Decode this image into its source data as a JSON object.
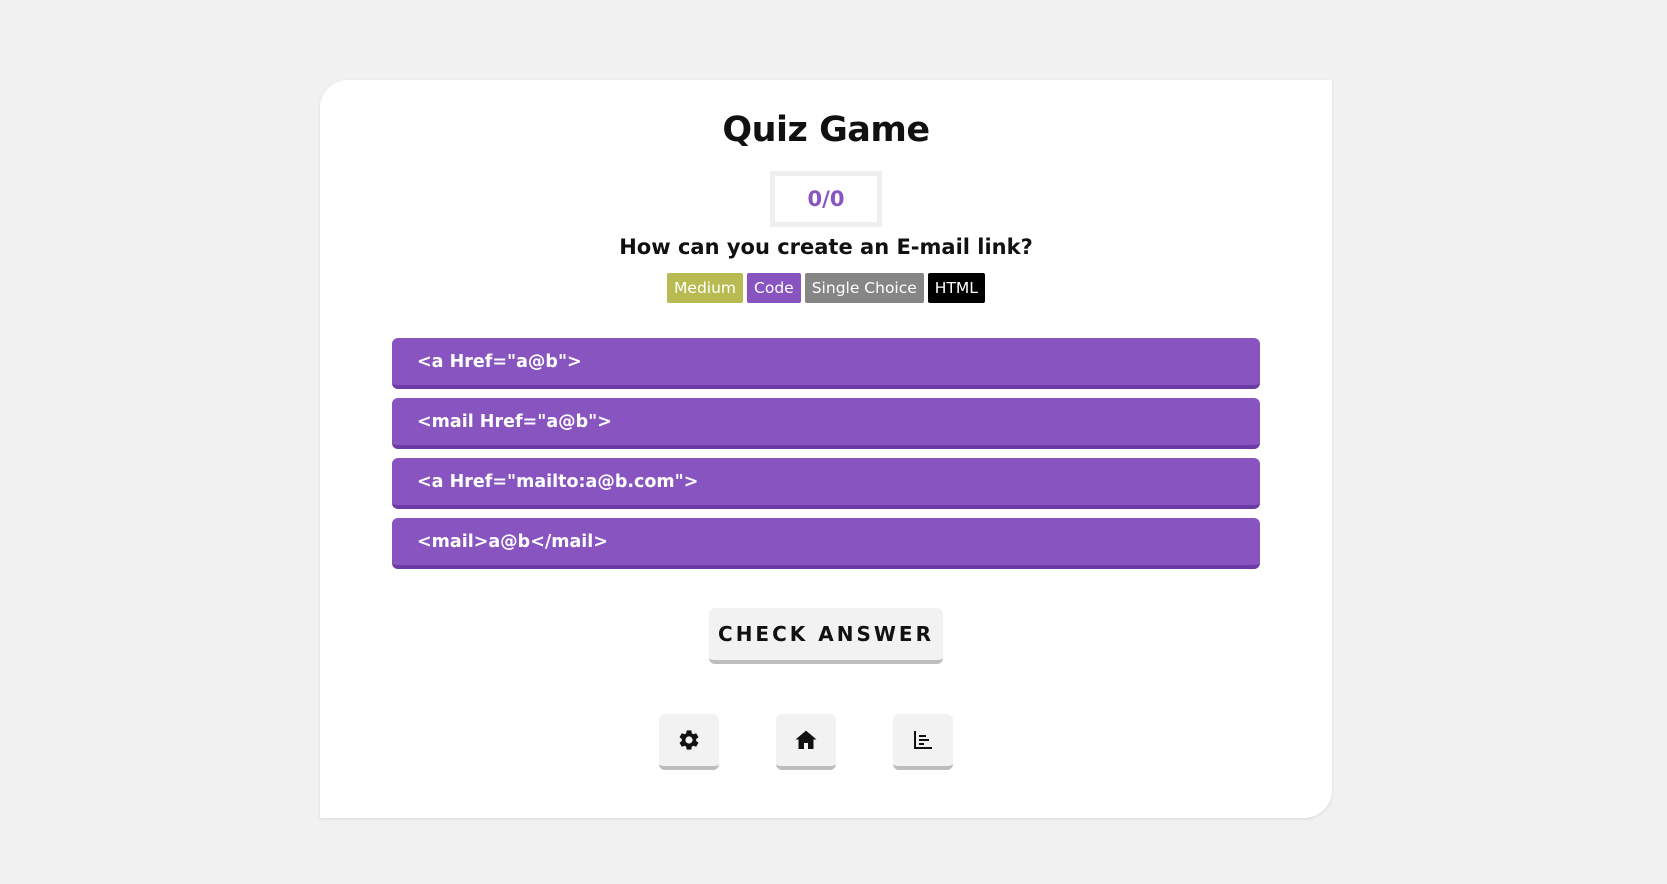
{
  "app": {
    "title": "Quiz Game"
  },
  "score": "0/0",
  "question": "How can you create an E-mail link?",
  "tags": [
    {
      "label": "Medium",
      "color": "#b8bb52"
    },
    {
      "label": "Code",
      "color": "#8854c0"
    },
    {
      "label": "Single Choice",
      "color": "#868686"
    },
    {
      "label": "HTML",
      "color": "#000000"
    }
  ],
  "answers": [
    "<a Href=\"a@b\">",
    "<mail Href=\"a@b\">",
    "<a Href=\"mailto:a@b.com\">",
    "<mail>a@b</mail>"
  ],
  "check_button": {
    "label": "CHECK ANSWER"
  },
  "nav": [
    {
      "icon": "gear-icon"
    },
    {
      "icon": "home-icon"
    },
    {
      "icon": "stats-icon"
    }
  ],
  "colors": {
    "accent": "#8854c0",
    "background": "#f1f1f1",
    "card": "#ffffff"
  }
}
